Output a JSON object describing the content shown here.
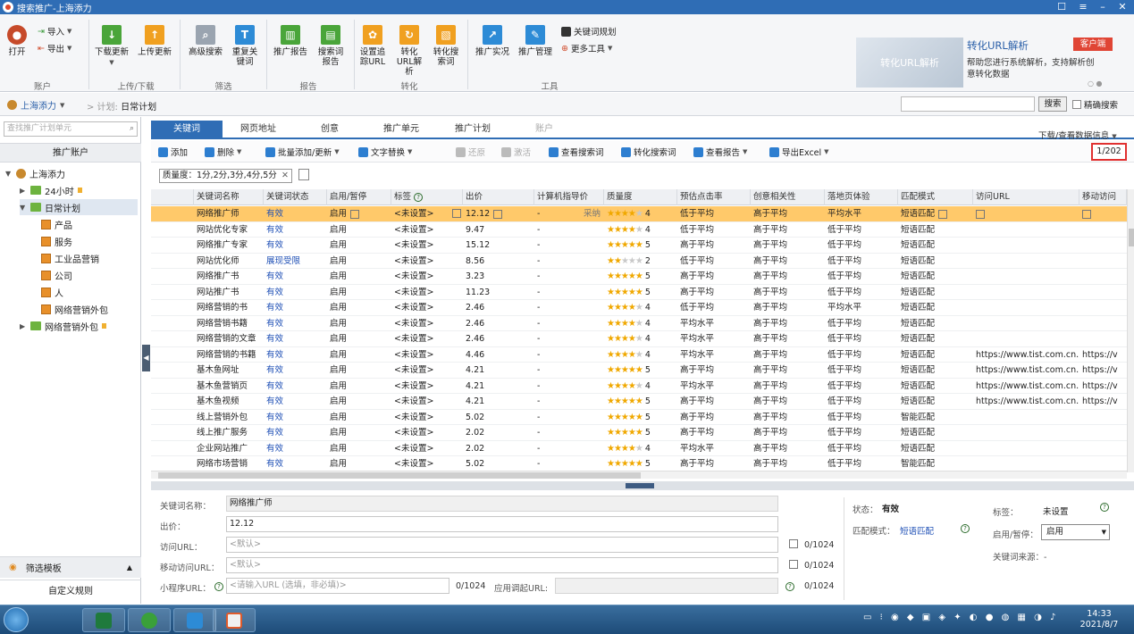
{
  "window": {
    "title": "搜索推广-上海添力"
  },
  "ribbon": {
    "account_btns": {
      "open": "打开",
      "import": "导入",
      "export": "导出"
    },
    "download": "下载更新",
    "upload": "上传更新",
    "adv_search": "高级搜索",
    "dup_kw": "重复关键词",
    "promo_report": "推广报告",
    "search_term_report": "搜索词报告",
    "set_track_url": "设置追踪URL",
    "convert_url": "转化URL解析",
    "convert_search": "转化搜索词",
    "realtime": "推广实况",
    "mgmt": "推广管理",
    "kw_plan": "关键词规划",
    "more_tools": "更多工具",
    "groups": {
      "account": "账户",
      "updown": "上传/下载",
      "filter": "筛选",
      "report": "报告",
      "convert": "转化",
      "tools": "工具"
    },
    "banner_text": "转化URL解析",
    "promo_title": "转化URL解析",
    "promo_desc": "帮助您进行系统解析，支持解析创意转化数据",
    "kefu": "客户端"
  },
  "nav": {
    "account": "上海添力",
    "plan_label": "> 计划:",
    "plan_name": "日常计划",
    "search_btn": "搜索",
    "exact": "精确搜索"
  },
  "sidebar": {
    "search_placeholder": "查找推广计划单元",
    "head": "推广账户",
    "tree": [
      {
        "label": "上海添力",
        "level": 0
      },
      {
        "label": "24小时",
        "level": 1
      },
      {
        "label": "日常计划",
        "level": 1
      },
      {
        "label": "产品",
        "level": 2
      },
      {
        "label": "服务",
        "level": 2
      },
      {
        "label": "工业品营销",
        "level": 2
      },
      {
        "label": "公司",
        "level": 2
      },
      {
        "label": "人",
        "level": 2
      },
      {
        "label": "网络营销外包",
        "level": 2
      },
      {
        "label": "网络营销外包",
        "level": 1
      }
    ],
    "filter_tpl": "筛选模板",
    "custom_rule": "自定义规则"
  },
  "tabs": [
    "关键词",
    "网页地址",
    "创意",
    "推广单元",
    "推广计划",
    "账户"
  ],
  "dl_info": "下载/查看数据信息",
  "toolbar": {
    "add": "添加",
    "del": "删除",
    "batch": "批量添加/更新",
    "replace": "文字替换",
    "restore": "还原",
    "activate": "激活",
    "view_search": "查看搜索词",
    "convert": "转化搜索词",
    "report": "查看报告",
    "export": "导出Excel"
  },
  "page_indicator": "1/202",
  "filter_chip": "质量度：1分,2分,3分,4分,5分",
  "columns": [
    "关键词名称",
    "关键词状态",
    "启用/暂停",
    "标签",
    "出价",
    "计算机指导价",
    "质量度",
    "预估点击率",
    "创意相关性",
    "落地页体验",
    "匹配模式",
    "访问URL",
    "移动访问"
  ],
  "rows": [
    {
      "name": "网络推广师",
      "status": "有效",
      "enable": "启用",
      "tag": "<未设置>",
      "bid": "12.12",
      "guide": "-",
      "q": 4,
      "ctr": "低于平均",
      "rel": "高于平均",
      "land": "平均水平",
      "match": "短语匹配",
      "url": "",
      "murl": "",
      "note": "采纳"
    },
    {
      "name": "网站优化专家",
      "status": "有效",
      "enable": "启用",
      "tag": "<未设置>",
      "bid": "9.47",
      "guide": "-",
      "q": 4,
      "ctr": "低于平均",
      "rel": "高于平均",
      "land": "低于平均",
      "match": "短语匹配",
      "url": "",
      "murl": ""
    },
    {
      "name": "网络推广专家",
      "status": "有效",
      "enable": "启用",
      "tag": "<未设置>",
      "bid": "15.12",
      "guide": "-",
      "q": 5,
      "ctr": "高于平均",
      "rel": "高于平均",
      "land": "低于平均",
      "match": "短语匹配",
      "url": "",
      "murl": ""
    },
    {
      "name": "网站优化师",
      "status": "展现受限",
      "enable": "启用",
      "tag": "<未设置>",
      "bid": "8.56",
      "guide": "-",
      "q": 2,
      "ctr": "低于平均",
      "rel": "高于平均",
      "land": "低于平均",
      "match": "短语匹配",
      "url": "",
      "murl": ""
    },
    {
      "name": "网络推广书",
      "status": "有效",
      "enable": "启用",
      "tag": "<未设置>",
      "bid": "3.23",
      "guide": "-",
      "q": 5,
      "ctr": "高于平均",
      "rel": "高于平均",
      "land": "低于平均",
      "match": "短语匹配",
      "url": "",
      "murl": ""
    },
    {
      "name": "网站推广书",
      "status": "有效",
      "enable": "启用",
      "tag": "<未设置>",
      "bid": "11.23",
      "guide": "-",
      "q": 5,
      "ctr": "高于平均",
      "rel": "高于平均",
      "land": "低于平均",
      "match": "短语匹配",
      "url": "",
      "murl": ""
    },
    {
      "name": "网络营销的书",
      "status": "有效",
      "enable": "启用",
      "tag": "<未设置>",
      "bid": "2.46",
      "guide": "-",
      "q": 4,
      "ctr": "低于平均",
      "rel": "高于平均",
      "land": "平均水平",
      "match": "短语匹配",
      "url": "",
      "murl": ""
    },
    {
      "name": "网络营销书籍",
      "status": "有效",
      "enable": "启用",
      "tag": "<未设置>",
      "bid": "2.46",
      "guide": "-",
      "q": 4,
      "ctr": "平均水平",
      "rel": "高于平均",
      "land": "低于平均",
      "match": "短语匹配",
      "url": "",
      "murl": ""
    },
    {
      "name": "网络营销的文章",
      "status": "有效",
      "enable": "启用",
      "tag": "<未设置>",
      "bid": "2.46",
      "guide": "-",
      "q": 4,
      "ctr": "平均水平",
      "rel": "高于平均",
      "land": "低于平均",
      "match": "短语匹配",
      "url": "",
      "murl": ""
    },
    {
      "name": "网络营销的书籍",
      "status": "有效",
      "enable": "启用",
      "tag": "<未设置>",
      "bid": "4.46",
      "guide": "-",
      "q": 4,
      "ctr": "平均水平",
      "rel": "高于平均",
      "land": "低于平均",
      "match": "短语匹配",
      "url": "https://www.tist.com.cn...",
      "murl": "https://v"
    },
    {
      "name": "基木鱼网址",
      "status": "有效",
      "enable": "启用",
      "tag": "<未设置>",
      "bid": "4.21",
      "guide": "-",
      "q": 5,
      "ctr": "高于平均",
      "rel": "高于平均",
      "land": "低于平均",
      "match": "短语匹配",
      "url": "https://www.tist.com.cn...",
      "murl": "https://v"
    },
    {
      "name": "基木鱼营销页",
      "status": "有效",
      "enable": "启用",
      "tag": "<未设置>",
      "bid": "4.21",
      "guide": "-",
      "q": 4,
      "ctr": "平均水平",
      "rel": "高于平均",
      "land": "低于平均",
      "match": "短语匹配",
      "url": "https://www.tist.com.cn...",
      "murl": "https://v"
    },
    {
      "name": "基木鱼视频",
      "status": "有效",
      "enable": "启用",
      "tag": "<未设置>",
      "bid": "4.21",
      "guide": "-",
      "q": 5,
      "ctr": "高于平均",
      "rel": "高于平均",
      "land": "低于平均",
      "match": "短语匹配",
      "url": "https://www.tist.com.cn...",
      "murl": "https://v"
    },
    {
      "name": "线上营销外包",
      "status": "有效",
      "enable": "启用",
      "tag": "<未设置>",
      "bid": "5.02",
      "guide": "-",
      "q": 5,
      "ctr": "高于平均",
      "rel": "高于平均",
      "land": "低于平均",
      "match": "智能匹配",
      "url": "",
      "murl": ""
    },
    {
      "name": "线上推广服务",
      "status": "有效",
      "enable": "启用",
      "tag": "<未设置>",
      "bid": "2.02",
      "guide": "-",
      "q": 5,
      "ctr": "高于平均",
      "rel": "高于平均",
      "land": "低于平均",
      "match": "短语匹配",
      "url": "",
      "murl": ""
    },
    {
      "name": "企业网站推广",
      "status": "有效",
      "enable": "启用",
      "tag": "<未设置>",
      "bid": "2.02",
      "guide": "-",
      "q": 4,
      "ctr": "平均水平",
      "rel": "高于平均",
      "land": "低于平均",
      "match": "短语匹配",
      "url": "",
      "murl": ""
    },
    {
      "name": "网络市场营销",
      "status": "有效",
      "enable": "启用",
      "tag": "<未设置>",
      "bid": "5.02",
      "guide": "-",
      "q": 5,
      "ctr": "高于平均",
      "rel": "高于平均",
      "land": "低于平均",
      "match": "智能匹配",
      "url": "",
      "murl": ""
    }
  ],
  "detail": {
    "kw_label": "关键词名称：",
    "kw_value": "网络推广师",
    "bid_label": "出价：",
    "bid_value": "12.12",
    "url_label": "访问URL：",
    "url_ph": "<默认>",
    "url_cnt": "0/1024",
    "murl_label": "移动访问URL：",
    "murl_ph": "<默认>",
    "murl_cnt": "0/1024",
    "mini_label": "小程序URL：",
    "mini_ph": "<请输入URL (选填，非必填)>",
    "mini_cnt": "0/1024",
    "app_label": "应用调起URL:",
    "app_cnt": "0/1024",
    "status_label": "状态：",
    "status_value": "有效",
    "match_label": "匹配模式：",
    "match_value": "短语匹配",
    "tag_label": "标签：",
    "tag_value": "未设置",
    "enable_label": "启用/暂停：",
    "enable_value": "启用",
    "source_label": "关键词来源：-"
  },
  "clock": {
    "time": "14:33",
    "date": "2021/8/7"
  }
}
